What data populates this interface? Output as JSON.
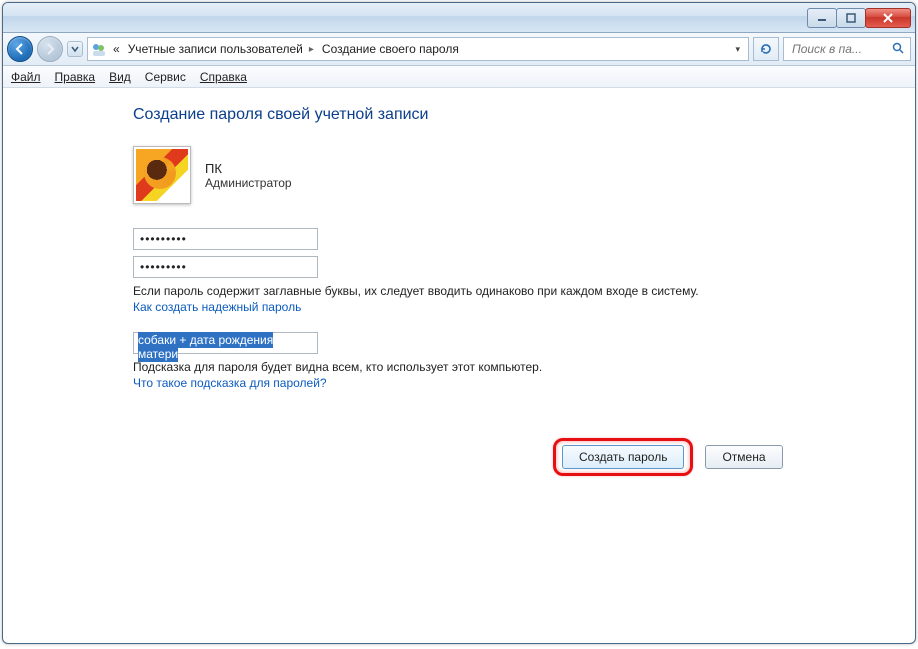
{
  "titlebar": {
    "minimize_icon": "minimize-icon",
    "maximize_icon": "maximize-icon",
    "close_icon": "close-icon"
  },
  "nav": {
    "breadcrumb_double_chevron": "«",
    "crumbs": [
      {
        "label": "Учетные записи пользователей"
      },
      {
        "label": "Создание своего пароля"
      }
    ],
    "search_placeholder": "Поиск в па..."
  },
  "menu": {
    "file": "Файл",
    "edit": "Правка",
    "view": "Вид",
    "tools": "Сервис",
    "help": "Справка"
  },
  "page": {
    "title": "Создание пароля своей учетной записи",
    "user_name": "ПК",
    "user_role": "Администратор",
    "password1": "•••••••••",
    "password2": "•••••••••",
    "caps_note": "Если пароль содержит заглавные буквы, их следует вводить одинаково при каждом входе в систему.",
    "link_strong": "Как создать надежный пароль",
    "hint_value": "собаки + дата рождения матери",
    "hint_note": "Подсказка для пароля будет видна всем, кто использует этот компьютер.",
    "link_hint": "Что такое подсказка для паролей?",
    "btn_create": "Создать пароль",
    "btn_cancel": "Отмена"
  }
}
